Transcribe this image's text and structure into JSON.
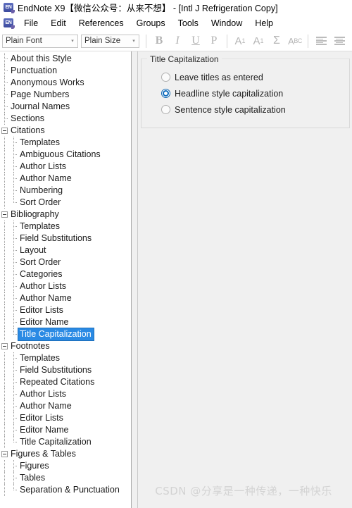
{
  "window": {
    "title": "EndNote X9【微信公众号：从来不想】 - [Intl J Refrigeration Copy]",
    "app_badge": "EN"
  },
  "menubar": {
    "items": [
      {
        "label": "File"
      },
      {
        "label": "Edit"
      },
      {
        "label": "References"
      },
      {
        "label": "Groups"
      },
      {
        "label": "Tools"
      },
      {
        "label": "Window"
      },
      {
        "label": "Help"
      }
    ]
  },
  "toolbar": {
    "font_combo": {
      "value": "Plain Font",
      "arrow": "▾"
    },
    "size_combo": {
      "value": "Plain Size",
      "arrow": "▾"
    },
    "buttons": [
      {
        "name": "bold-button",
        "label": "B"
      },
      {
        "name": "italic-button",
        "label": "I"
      },
      {
        "name": "underline-button",
        "label": "U"
      },
      {
        "name": "plain-button",
        "label": "P"
      },
      {
        "name": "superscript-button",
        "label": "A",
        "affix": "1"
      },
      {
        "name": "subscript-button",
        "label": "A",
        "affix": "1"
      },
      {
        "name": "symbol-button",
        "label": "Σ"
      },
      {
        "name": "spellcheck-button",
        "label": "A",
        "affix": "BC"
      },
      {
        "name": "align-left-button",
        "label": ""
      },
      {
        "name": "align-center-button",
        "label": ""
      }
    ]
  },
  "tree": {
    "items": [
      {
        "label": "About this Style",
        "level": 0,
        "type": "leaf"
      },
      {
        "label": "Punctuation",
        "level": 0,
        "type": "leaf"
      },
      {
        "label": "Anonymous Works",
        "level": 0,
        "type": "leaf"
      },
      {
        "label": "Page Numbers",
        "level": 0,
        "type": "leaf"
      },
      {
        "label": "Journal Names",
        "level": 0,
        "type": "leaf"
      },
      {
        "label": "Sections",
        "level": 0,
        "type": "leaf"
      },
      {
        "label": "Citations",
        "level": 0,
        "type": "group"
      },
      {
        "label": "Templates",
        "level": 1,
        "type": "leaf"
      },
      {
        "label": "Ambiguous Citations",
        "level": 1,
        "type": "leaf"
      },
      {
        "label": "Author Lists",
        "level": 1,
        "type": "leaf"
      },
      {
        "label": "Author Name",
        "level": 1,
        "type": "leaf"
      },
      {
        "label": "Numbering",
        "level": 1,
        "type": "leaf"
      },
      {
        "label": "Sort Order",
        "level": 1,
        "type": "leaf-last"
      },
      {
        "label": "Bibliography",
        "level": 0,
        "type": "group"
      },
      {
        "label": "Templates",
        "level": 1,
        "type": "leaf"
      },
      {
        "label": "Field Substitutions",
        "level": 1,
        "type": "leaf"
      },
      {
        "label": "Layout",
        "level": 1,
        "type": "leaf"
      },
      {
        "label": "Sort Order",
        "level": 1,
        "type": "leaf"
      },
      {
        "label": "Categories",
        "level": 1,
        "type": "leaf"
      },
      {
        "label": "Author Lists",
        "level": 1,
        "type": "leaf"
      },
      {
        "label": "Author Name",
        "level": 1,
        "type": "leaf"
      },
      {
        "label": "Editor Lists",
        "level": 1,
        "type": "leaf"
      },
      {
        "label": "Editor Name",
        "level": 1,
        "type": "leaf"
      },
      {
        "label": "Title Capitalization",
        "level": 1,
        "type": "leaf-last",
        "selected": true
      },
      {
        "label": "Footnotes",
        "level": 0,
        "type": "group"
      },
      {
        "label": "Templates",
        "level": 1,
        "type": "leaf"
      },
      {
        "label": "Field Substitutions",
        "level": 1,
        "type": "leaf"
      },
      {
        "label": "Repeated Citations",
        "level": 1,
        "type": "leaf"
      },
      {
        "label": "Author Lists",
        "level": 1,
        "type": "leaf"
      },
      {
        "label": "Author Name",
        "level": 1,
        "type": "leaf"
      },
      {
        "label": "Editor Lists",
        "level": 1,
        "type": "leaf"
      },
      {
        "label": "Editor Name",
        "level": 1,
        "type": "leaf"
      },
      {
        "label": "Title Capitalization",
        "level": 1,
        "type": "leaf-last"
      },
      {
        "label": "Figures & Tables",
        "level": 0,
        "type": "group"
      },
      {
        "label": "Figures",
        "level": 1,
        "type": "leaf"
      },
      {
        "label": "Tables",
        "level": 1,
        "type": "leaf"
      },
      {
        "label": "Separation & Punctuation",
        "level": 1,
        "type": "leaf-last"
      }
    ],
    "selection_color": "#2a8ae4"
  },
  "panel": {
    "group_title": "Title Capitalization",
    "options": [
      {
        "label": "Leave titles as entered",
        "checked": false
      },
      {
        "label": "Headline style capitalization",
        "checked": true
      },
      {
        "label": "Sentence style capitalization",
        "checked": false
      }
    ],
    "accent_color": "#0f6cbd"
  },
  "watermark": {
    "text": "CSDN @分享是一种传递，一种快乐",
    "color": "#d3d3d3"
  }
}
